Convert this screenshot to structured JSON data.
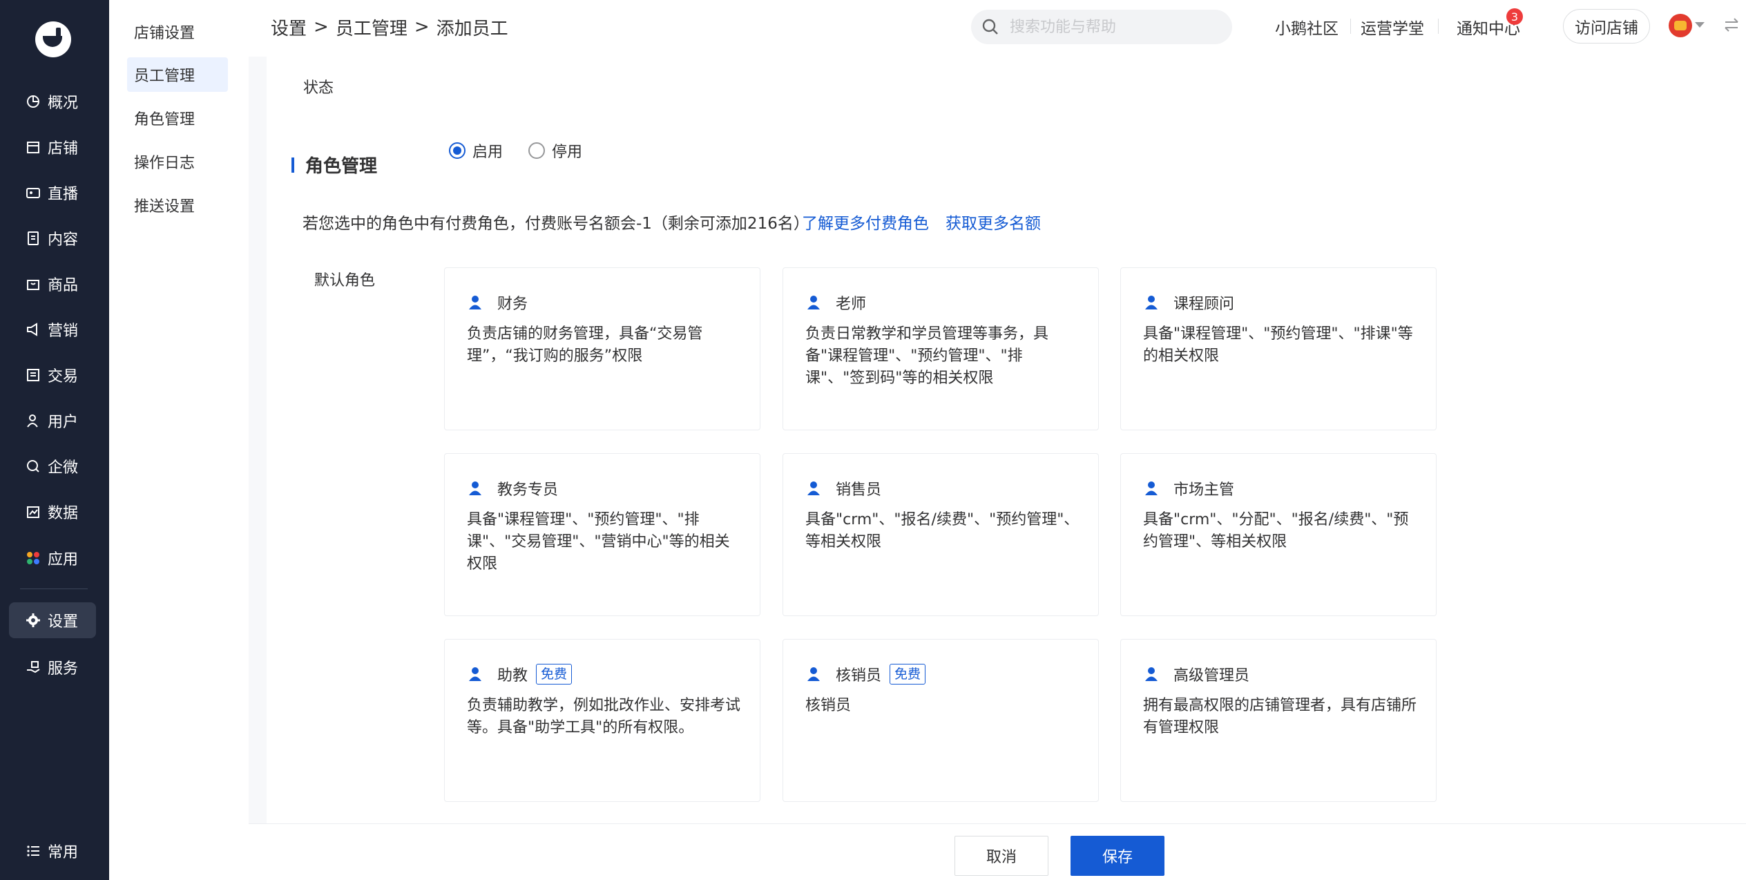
{
  "nav": {
    "items": [
      {
        "label": "概况",
        "icon": "pie-chart-icon"
      },
      {
        "label": "店铺",
        "icon": "store-icon"
      },
      {
        "label": "直播",
        "icon": "live-icon"
      },
      {
        "label": "内容",
        "icon": "document-icon"
      },
      {
        "label": "商品",
        "icon": "goods-box-icon"
      },
      {
        "label": "营销",
        "icon": "megaphone-icon"
      },
      {
        "label": "交易",
        "icon": "receipt-icon"
      },
      {
        "label": "用户",
        "icon": "user-icon"
      },
      {
        "label": "企微",
        "icon": "wecom-chat-icon"
      },
      {
        "label": "数据",
        "icon": "data-chart-icon"
      },
      {
        "label": "应用",
        "icon": "apps-grid-icon"
      },
      {
        "label": "设置",
        "icon": "gear-icon"
      },
      {
        "label": "服务",
        "icon": "service-hand-icon"
      }
    ],
    "active": "设置",
    "bottom_label": "常用",
    "bottom_icon": "list-icon"
  },
  "submenu": {
    "items": [
      "店铺设置",
      "员工管理",
      "角色管理",
      "操作日志",
      "推送设置"
    ],
    "active": "员工管理"
  },
  "breadcrumb": [
    "设置",
    "员工管理",
    "添加员工"
  ],
  "breadcrumb_sep": ">",
  "search": {
    "placeholder": "搜索功能与帮助"
  },
  "top_links": [
    "小鹅社区",
    "运营学堂",
    "通知中心"
  ],
  "notification_count": "3",
  "visit_store_label": "访问店铺",
  "form": {
    "status_label": "状态",
    "status_options": [
      "启用",
      "停用"
    ],
    "status_selected": "启用"
  },
  "role_section": {
    "title": "角色管理",
    "quota_tip": "若您选中的角色中有付费角色，付费账号名额会-1（剩余可添加216名）",
    "learn_more_link": "了解更多付费角色",
    "get_more_link": "获取更多名额",
    "default_roles_label": "默认角色",
    "roles": [
      {
        "name": "财务",
        "desc": "负责店铺的财务管理，具备“交易管理”，“我订购的服务”权限",
        "tag": ""
      },
      {
        "name": "老师",
        "desc": "负责日常教学和学员管理等事务，具备\"课程管理\"、\"预约管理\"、\"排课\"、\"签到码\"等的相关权限",
        "tag": ""
      },
      {
        "name": "课程顾问",
        "desc": "具备\"课程管理\"、\"预约管理\"、\"排课\"等的相关权限",
        "tag": ""
      },
      {
        "name": "教务专员",
        "desc": "具备\"课程管理\"、\"预约管理\"、\"排课\"、\"交易管理\"、\"营销中心\"等的相关权限",
        "tag": ""
      },
      {
        "name": "销售员",
        "desc": "具备\"crm\"、\"报名/续费\"、\"预约管理\"、等相关权限",
        "tag": ""
      },
      {
        "name": "市场主管",
        "desc": "具备\"crm\"、\"分配\"、\"报名/续费\"、\"预约管理\"、等相关权限",
        "tag": ""
      },
      {
        "name": "助教",
        "desc": "负责辅助教学，例如批改作业、安排考试等。具备\"助学工具\"的所有权限。",
        "tag": "免费"
      },
      {
        "name": "核销员",
        "desc": "核销员",
        "tag": "免费"
      },
      {
        "name": "高级管理员",
        "desc": "拥有最高权限的店铺管理者，具有店铺所有管理权限",
        "tag": ""
      }
    ]
  },
  "footer": {
    "cancel_label": "取消",
    "save_label": "保存"
  },
  "colors": {
    "primary": "#155bd4",
    "nav_bg": "#1b2234",
    "badge": "#ee3c3c"
  }
}
